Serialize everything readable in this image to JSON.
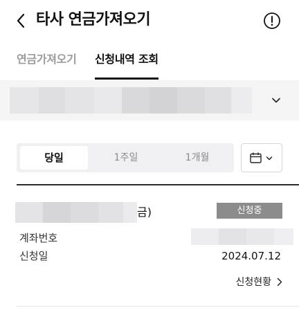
{
  "header": {
    "title": "타사 연금가져오기",
    "back_icon": "chevron-left-icon",
    "info_icon": "exclamation-circle-icon"
  },
  "tabs": [
    {
      "label": "연금가져오기",
      "active": false
    },
    {
      "label": "신청내역 조회",
      "active": true
    }
  ],
  "account_selector": {
    "dropdown_icon": "chevron-down-icon"
  },
  "period_filter": {
    "options": [
      "당일",
      "1주일",
      "1개월"
    ],
    "selected": "당일",
    "calendar_icon": "calendar-icon"
  },
  "application": {
    "name_suffix": "금)",
    "status": "신청중",
    "account_label": "계좌번호",
    "date_label": "신청일",
    "date_value": "2024.07.12",
    "link_label": "신청현황"
  },
  "colors": {
    "badge_bg": "#8c8c8c",
    "segment_bg": "#f0f0f2",
    "account_bar_bg": "#f5f5f6",
    "inactive_tab": "#9a9a9a"
  }
}
